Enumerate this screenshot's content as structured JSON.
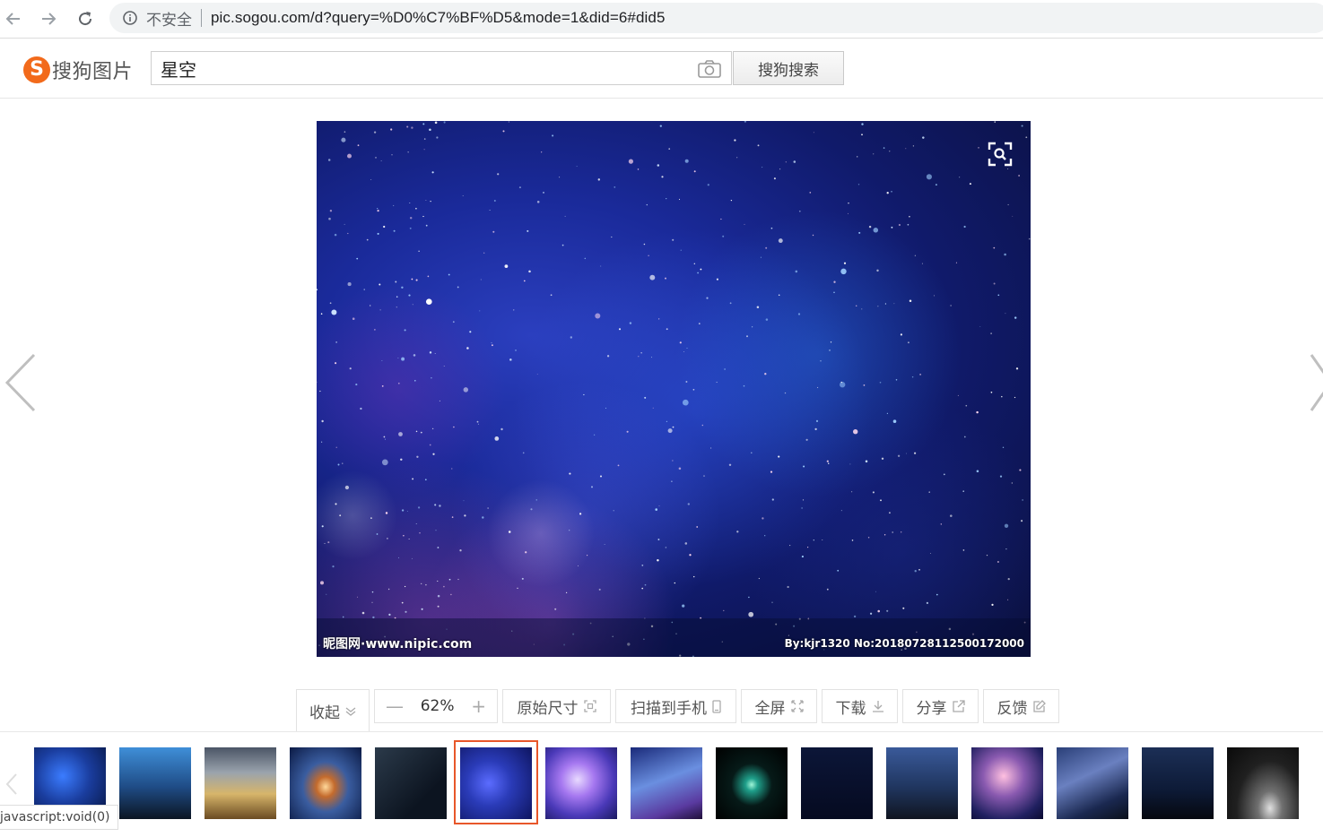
{
  "browser": {
    "security_label": "不安全",
    "url": "pic.sogou.com/d?query=%D0%C7%BF%D5&mode=1&did=6#did5"
  },
  "header": {
    "logo_mark": "S",
    "logo_text": "搜狗图片",
    "search_value": "星空",
    "search_button": "搜狗搜索"
  },
  "viewer": {
    "watermark_left": "昵图网·www.nipic.com",
    "watermark_right": "By:kjr1320 No:20180728112500172000"
  },
  "toolbar": {
    "collapse_label": "收起",
    "zoom_minus": "—",
    "zoom_value": "62%",
    "zoom_plus": "+",
    "original_size": "原始尺寸",
    "scan_to_phone": "扫描到手机",
    "fullscreen": "全屏",
    "download": "下载",
    "share": "分享",
    "feedback": "反馈"
  },
  "status_bar": "javascript:void(0)",
  "colors": {
    "brand": "#f26a1b",
    "selected_border": "#e8572a"
  },
  "thumbnails": {
    "count": 15,
    "selected_index": 5
  }
}
